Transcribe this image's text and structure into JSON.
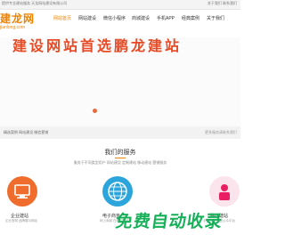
{
  "topbar": {
    "left_text": "提供专业建站服务  天龙网站建设有限公司",
    "right_text": "关于我们  联系我们"
  },
  "logo": {
    "title": "建龙网",
    "subtitle": "jianlong.com"
  },
  "nav": [
    {
      "label": "网站首页"
    },
    {
      "label": "网站建设"
    },
    {
      "label": "微信小程序"
    },
    {
      "label": "商城建设"
    },
    {
      "label": "手机APP"
    },
    {
      "label": "经典案例"
    },
    {
      "label": "关于我们"
    }
  ],
  "banner": {
    "title": "建设网站首选鹏龙建站"
  },
  "linkbar": {
    "left": "精选案例  网站建设  微信营销",
    "right": "更多服务请联系我们"
  },
  "services": {
    "title": "我们的服务",
    "subtitle": "服务于不同类型用户 网站建设 定制建站 移动建站 营销服务",
    "cards": [
      {
        "label": "企业建站",
        "desc": "企业官网 品牌展示网站"
      },
      {
        "label": "电子商务",
        "desc": "网上商城 在线购物系统"
      },
      {
        "label": "移动建站",
        "desc": "手机网站 微信公众平台"
      }
    ]
  },
  "watermark": "免费自动收录",
  "colors": {
    "brand": "#f08300",
    "banner_text": "#e84a24",
    "circle_1": "#ef6c2d",
    "circle_2": "#2ca5dc",
    "circle_3": "#fce4ec",
    "watermark": "#16b058"
  }
}
